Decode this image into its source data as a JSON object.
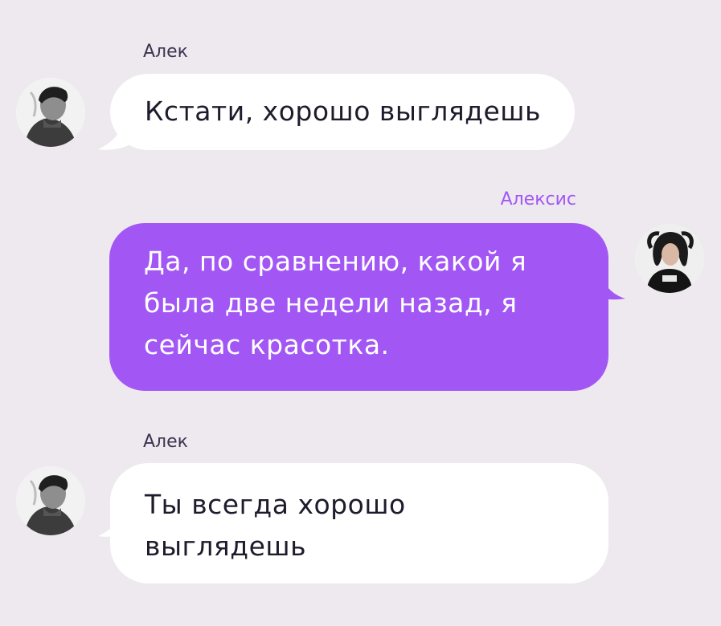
{
  "chat": {
    "messages": [
      {
        "sender": "Алек",
        "text": "Кстати, хорошо выглядешь",
        "side": "left",
        "avatar_icon": "alek-avatar-icon"
      },
      {
        "sender": "Алексис",
        "text": "Да, по сравнению, какой я была две недели назад, я сейчас красотка.",
        "side": "right",
        "avatar_icon": "aleksis-avatar-icon"
      },
      {
        "sender": "Алек",
        "text": "Ты всегда хорошо выглядешь",
        "side": "left",
        "avatar_icon": "alek-avatar-icon"
      }
    ]
  },
  "colors": {
    "background": "#eee9ee",
    "incoming_bubble": "#ffffff",
    "outgoing_bubble": "#a257f5",
    "incoming_text": "#1e1c2c",
    "outgoing_text": "#ffffff",
    "my_name": "#a257f5",
    "other_name": "#3a3550"
  }
}
